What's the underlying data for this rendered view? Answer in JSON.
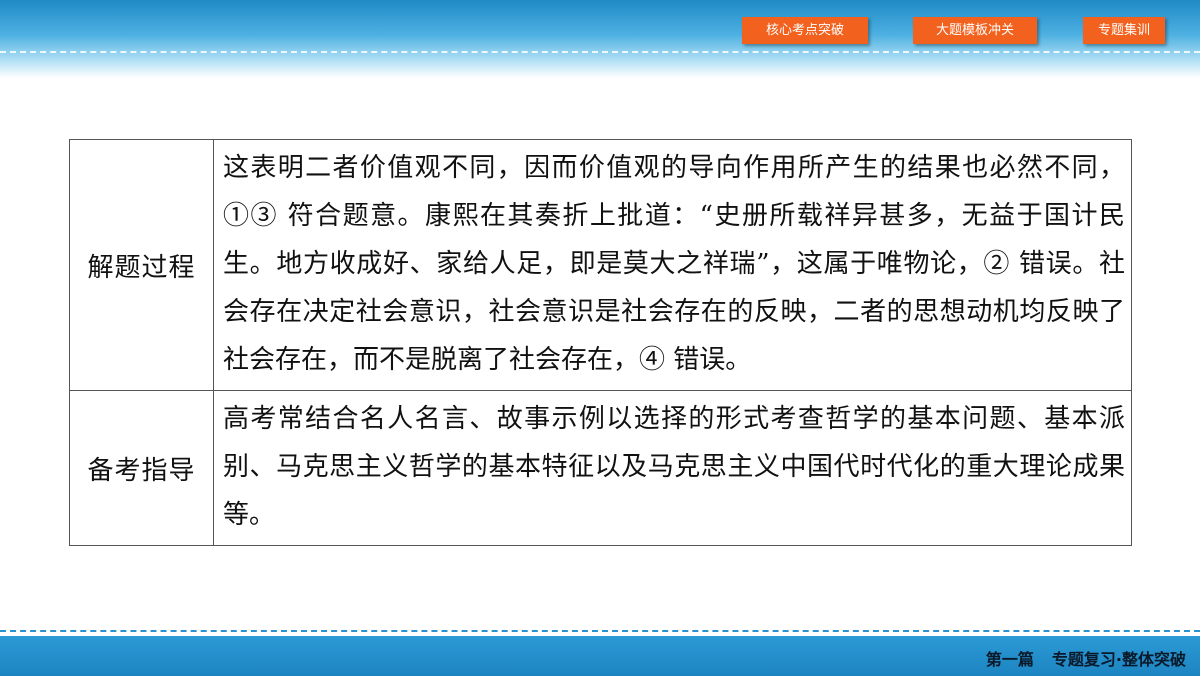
{
  "header": {
    "nav": [
      {
        "label": "核心考点突破"
      },
      {
        "label": "大题模板冲关"
      },
      {
        "label": "专题集训"
      }
    ],
    "accent_color": "#f2611d",
    "band_color": "#1f8ac6"
  },
  "table": {
    "rows": [
      {
        "label": "解题过程",
        "content": "这表明二者价值观不同，因而价值观的导向作用所产生的结果也必然不同，①③ 符合题意。康熙在其奏折上批道：“史册所载祥异甚多，无益于国计民生。地方收成好、家给人足，即是莫大之祥瑞”，这属于唯物论，② 错误。社会存在决定社会意识，社会意识是社会存在的反映，二者的思想动机均反映了社会存在，而不是脱离了社会存在，④ 错误。"
      },
      {
        "label": "备考指导",
        "content": "高考常结合名人名言、故事示例以选择的形式考查哲学的基本问题、基本派别、马克思主义哲学的基本特征以及马克思主义中国代时代化的重大理论成果等。"
      }
    ]
  },
  "footer": {
    "part": "第一篇",
    "section": "专题复习·整体突破"
  }
}
